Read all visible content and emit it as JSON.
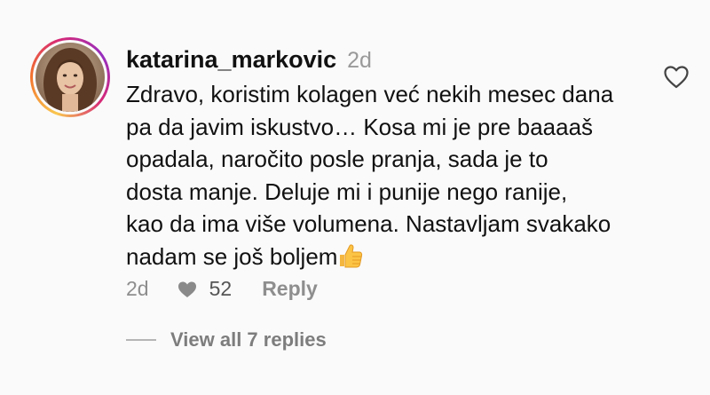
{
  "comment": {
    "username": "katarina_markovic",
    "time": "2d",
    "text_lines": [
      "Zdravo, koristim kolagen već nekih mesec dana",
      "pa da javim iskustvo… Kosa mi je pre baaaaš",
      "opadala, naročito posle pranja, sada je to",
      "dosta manje. Deluje mi i punije nego ranije,",
      "kao da ima više volumena. Nastavljam svakako",
      "nadam se još boljem"
    ],
    "emoji": "thumbs-up-icon",
    "footer": {
      "time": "2d",
      "likes": "52",
      "reply_label": "Reply"
    },
    "view_replies_label": "View all 7 replies"
  },
  "icons": {
    "like": "heart-outline-icon",
    "footer_like": "heart-filled-icon"
  },
  "colors": {
    "background": "#fafafa",
    "text": "#111111",
    "muted": "#8e8e8e",
    "story_ring": [
      "#f9c74f",
      "#f3722c",
      "#d62976",
      "#962fbf"
    ]
  }
}
